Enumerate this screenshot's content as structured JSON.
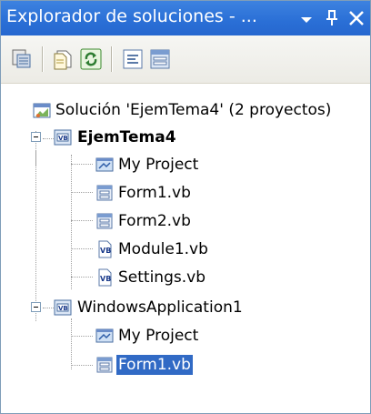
{
  "window": {
    "title": "Explorador de soluciones - ...",
    "accent_color": "#2a6fd6"
  },
  "title_buttons": {
    "dropdown_icon": "chevron-down-icon",
    "pin_icon": "pin-icon",
    "close_icon": "close-icon"
  },
  "toolbar": {
    "buttons": [
      {
        "icon": "properties-icon"
      },
      {
        "icon": "show-all-files-icon"
      },
      {
        "icon": "refresh-icon"
      },
      {
        "icon": "view-code-icon"
      },
      {
        "icon": "view-designer-icon"
      }
    ]
  },
  "tree": {
    "solution": {
      "label": "Solución 'EjemTema4'  (2 proyectos)",
      "icon": "solution-icon"
    },
    "project1": {
      "label": "EjemTema4",
      "icon": "vb-project-icon",
      "expanded": true,
      "bold": true,
      "items": [
        {
          "label": "My Project",
          "icon": "my-project-icon"
        },
        {
          "label": "Form1.vb",
          "icon": "form-icon"
        },
        {
          "label": "Form2.vb",
          "icon": "form-icon"
        },
        {
          "label": "Module1.vb",
          "icon": "vb-file-icon"
        },
        {
          "label": "Settings.vb",
          "icon": "vb-file-icon"
        }
      ]
    },
    "project2": {
      "label": "WindowsApplication1",
      "icon": "vb-project-icon",
      "expanded": true,
      "items": [
        {
          "label": "My Project",
          "icon": "my-project-icon"
        },
        {
          "label": "Form1.vb",
          "icon": "form-icon",
          "selected": true
        }
      ]
    }
  }
}
